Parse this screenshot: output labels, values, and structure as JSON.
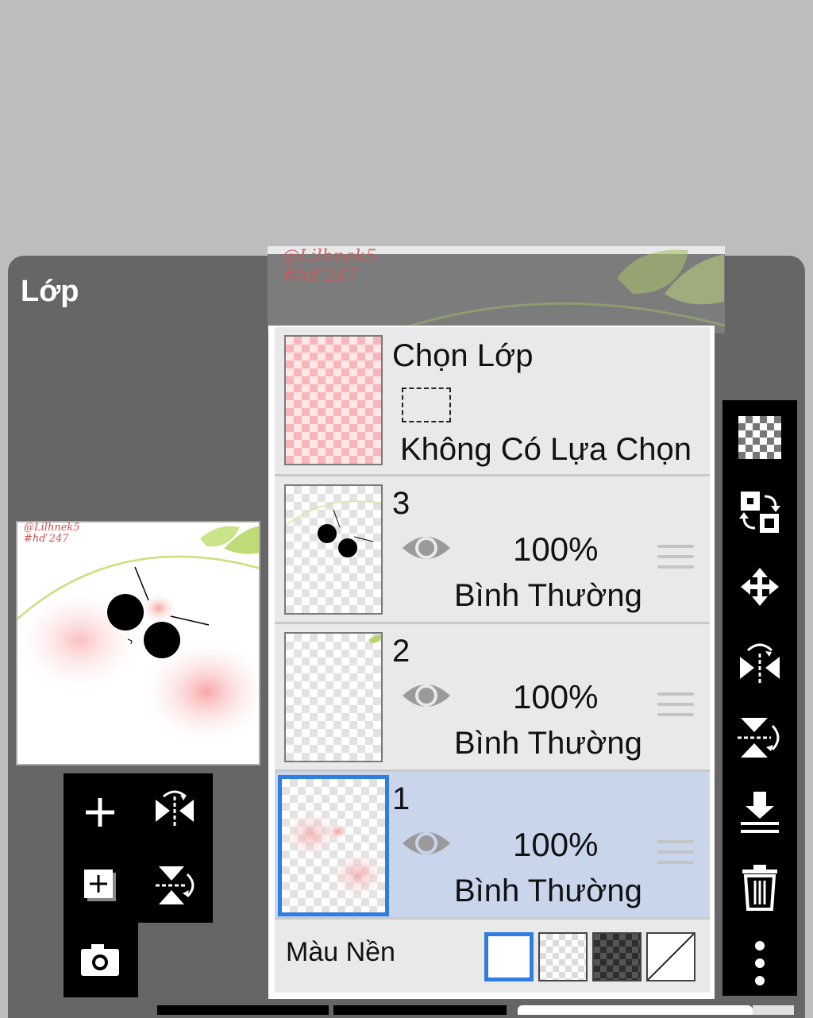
{
  "panel": {
    "title": "Lớp"
  },
  "watermark": {
    "line1": "@Lilhnek5",
    "line2": "#hď 247"
  },
  "selection_layer": {
    "title": "Chọn Lớp",
    "status": "Không Có Lựa Chọn"
  },
  "layers": [
    {
      "number": "3",
      "opacity": "100%",
      "blend": "Bình Thường",
      "selected": false
    },
    {
      "number": "2",
      "opacity": "100%",
      "blend": "Bình Thường",
      "selected": false
    },
    {
      "number": "1",
      "opacity": "100%",
      "blend": "Bình Thường",
      "selected": true
    }
  ],
  "background": {
    "label": "Màu Nền",
    "options": [
      "white",
      "checker",
      "dark-checker",
      "none"
    ],
    "selected": "white"
  },
  "colors": {
    "accent": "#2f7de1",
    "panel": "#666666",
    "toolbar": "#000000",
    "selected_row": "#c8d5ea"
  },
  "left_toolbar": [
    "add-layer-icon",
    "flip-horizontal-icon",
    "add-layer-copy-icon",
    "flip-vertical-icon",
    "camera-icon"
  ],
  "right_toolbar": [
    "transparency-icon",
    "swap-layer-icon",
    "move-icon",
    "flip-horizontal-icon",
    "flip-vertical-icon",
    "merge-down-icon",
    "trash-icon",
    "more-icon"
  ]
}
